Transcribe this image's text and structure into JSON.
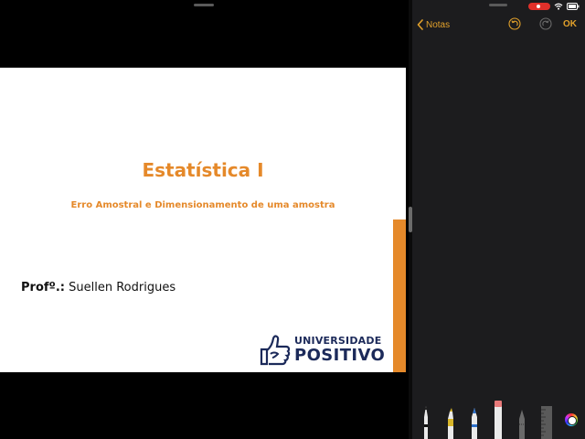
{
  "slide": {
    "title": "Estatística I",
    "subtitle": "Erro Amostral e Dimensionamento de uma amostra",
    "prof_label": "Profº.:",
    "prof_name": " Suellen Rodrigues",
    "logo_line1": "UNIVERSIDADE",
    "logo_line2": "POSITIVO"
  },
  "notes": {
    "back_label": "Notas",
    "ok_label": "OK"
  },
  "colors": {
    "accent_orange": "#e5892a",
    "ios_yellow": "#e2a12b",
    "logo_navy": "#1c2a5a",
    "notes_bg": "#1c1c1e"
  },
  "icons": {
    "back": "chevron-left-icon",
    "undo": "undo-icon",
    "redo": "redo-icon",
    "recording": "screen-recording-icon",
    "wifi": "wifi-icon",
    "battery": "battery-icon",
    "tools": [
      "pen-icon",
      "marker-icon",
      "pencil-blue-icon",
      "eraser-icon",
      "lasso-icon",
      "ruler-icon",
      "color-palette-icon"
    ]
  }
}
